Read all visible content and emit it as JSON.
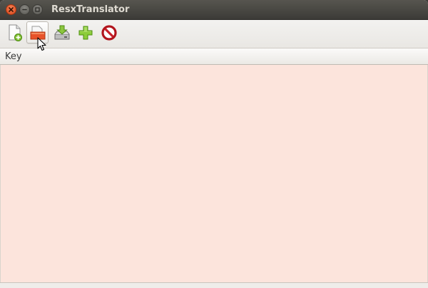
{
  "window": {
    "title": "ResxTranslator"
  },
  "toolbar": {
    "buttons": [
      {
        "name": "new-file-button",
        "icon": "new-document-icon"
      },
      {
        "name": "open-file-button",
        "icon": "open-folder-icon",
        "hover": true
      },
      {
        "name": "save-button",
        "icon": "save-drive-icon"
      },
      {
        "name": "add-button",
        "icon": "green-plus-icon"
      },
      {
        "name": "delete-button",
        "icon": "red-stop-icon"
      }
    ]
  },
  "table": {
    "columns": [
      {
        "label": "Key"
      }
    ],
    "background": "#fce4dc"
  },
  "colors": {
    "titlebar": "#3c3b37",
    "close_button": "#e9541f"
  }
}
